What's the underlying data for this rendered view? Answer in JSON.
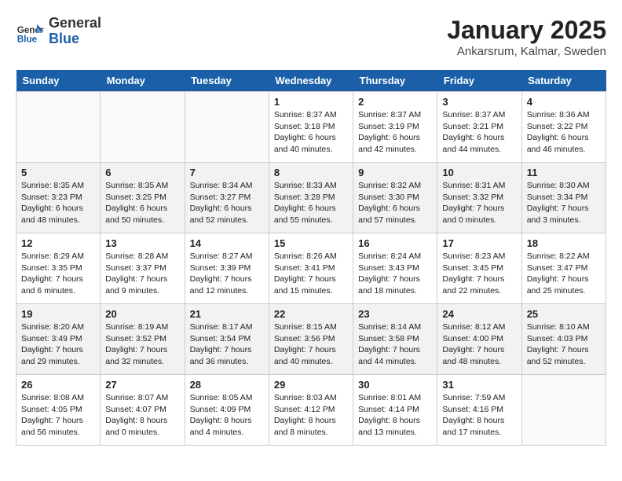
{
  "header": {
    "logo_general": "General",
    "logo_blue": "Blue",
    "title": "January 2025",
    "subtitle": "Ankarsrum, Kalmar, Sweden"
  },
  "weekdays": [
    "Sunday",
    "Monday",
    "Tuesday",
    "Wednesday",
    "Thursday",
    "Friday",
    "Saturday"
  ],
  "weeks": [
    [
      {
        "day": "",
        "info": ""
      },
      {
        "day": "",
        "info": ""
      },
      {
        "day": "",
        "info": ""
      },
      {
        "day": "1",
        "info": "Sunrise: 8:37 AM\nSunset: 3:18 PM\nDaylight: 6 hours\nand 40 minutes."
      },
      {
        "day": "2",
        "info": "Sunrise: 8:37 AM\nSunset: 3:19 PM\nDaylight: 6 hours\nand 42 minutes."
      },
      {
        "day": "3",
        "info": "Sunrise: 8:37 AM\nSunset: 3:21 PM\nDaylight: 6 hours\nand 44 minutes."
      },
      {
        "day": "4",
        "info": "Sunrise: 8:36 AM\nSunset: 3:22 PM\nDaylight: 6 hours\nand 46 minutes."
      }
    ],
    [
      {
        "day": "5",
        "info": "Sunrise: 8:35 AM\nSunset: 3:23 PM\nDaylight: 6 hours\nand 48 minutes."
      },
      {
        "day": "6",
        "info": "Sunrise: 8:35 AM\nSunset: 3:25 PM\nDaylight: 6 hours\nand 50 minutes."
      },
      {
        "day": "7",
        "info": "Sunrise: 8:34 AM\nSunset: 3:27 PM\nDaylight: 6 hours\nand 52 minutes."
      },
      {
        "day": "8",
        "info": "Sunrise: 8:33 AM\nSunset: 3:28 PM\nDaylight: 6 hours\nand 55 minutes."
      },
      {
        "day": "9",
        "info": "Sunrise: 8:32 AM\nSunset: 3:30 PM\nDaylight: 6 hours\nand 57 minutes."
      },
      {
        "day": "10",
        "info": "Sunrise: 8:31 AM\nSunset: 3:32 PM\nDaylight: 7 hours\nand 0 minutes."
      },
      {
        "day": "11",
        "info": "Sunrise: 8:30 AM\nSunset: 3:34 PM\nDaylight: 7 hours\nand 3 minutes."
      }
    ],
    [
      {
        "day": "12",
        "info": "Sunrise: 8:29 AM\nSunset: 3:35 PM\nDaylight: 7 hours\nand 6 minutes."
      },
      {
        "day": "13",
        "info": "Sunrise: 8:28 AM\nSunset: 3:37 PM\nDaylight: 7 hours\nand 9 minutes."
      },
      {
        "day": "14",
        "info": "Sunrise: 8:27 AM\nSunset: 3:39 PM\nDaylight: 7 hours\nand 12 minutes."
      },
      {
        "day": "15",
        "info": "Sunrise: 8:26 AM\nSunset: 3:41 PM\nDaylight: 7 hours\nand 15 minutes."
      },
      {
        "day": "16",
        "info": "Sunrise: 8:24 AM\nSunset: 3:43 PM\nDaylight: 7 hours\nand 18 minutes."
      },
      {
        "day": "17",
        "info": "Sunrise: 8:23 AM\nSunset: 3:45 PM\nDaylight: 7 hours\nand 22 minutes."
      },
      {
        "day": "18",
        "info": "Sunrise: 8:22 AM\nSunset: 3:47 PM\nDaylight: 7 hours\nand 25 minutes."
      }
    ],
    [
      {
        "day": "19",
        "info": "Sunrise: 8:20 AM\nSunset: 3:49 PM\nDaylight: 7 hours\nand 29 minutes."
      },
      {
        "day": "20",
        "info": "Sunrise: 8:19 AM\nSunset: 3:52 PM\nDaylight: 7 hours\nand 32 minutes."
      },
      {
        "day": "21",
        "info": "Sunrise: 8:17 AM\nSunset: 3:54 PM\nDaylight: 7 hours\nand 36 minutes."
      },
      {
        "day": "22",
        "info": "Sunrise: 8:15 AM\nSunset: 3:56 PM\nDaylight: 7 hours\nand 40 minutes."
      },
      {
        "day": "23",
        "info": "Sunrise: 8:14 AM\nSunset: 3:58 PM\nDaylight: 7 hours\nand 44 minutes."
      },
      {
        "day": "24",
        "info": "Sunrise: 8:12 AM\nSunset: 4:00 PM\nDaylight: 7 hours\nand 48 minutes."
      },
      {
        "day": "25",
        "info": "Sunrise: 8:10 AM\nSunset: 4:03 PM\nDaylight: 7 hours\nand 52 minutes."
      }
    ],
    [
      {
        "day": "26",
        "info": "Sunrise: 8:08 AM\nSunset: 4:05 PM\nDaylight: 7 hours\nand 56 minutes."
      },
      {
        "day": "27",
        "info": "Sunrise: 8:07 AM\nSunset: 4:07 PM\nDaylight: 8 hours\nand 0 minutes."
      },
      {
        "day": "28",
        "info": "Sunrise: 8:05 AM\nSunset: 4:09 PM\nDaylight: 8 hours\nand 4 minutes."
      },
      {
        "day": "29",
        "info": "Sunrise: 8:03 AM\nSunset: 4:12 PM\nDaylight: 8 hours\nand 8 minutes."
      },
      {
        "day": "30",
        "info": "Sunrise: 8:01 AM\nSunset: 4:14 PM\nDaylight: 8 hours\nand 13 minutes."
      },
      {
        "day": "31",
        "info": "Sunrise: 7:59 AM\nSunset: 4:16 PM\nDaylight: 8 hours\nand 17 minutes."
      },
      {
        "day": "",
        "info": ""
      }
    ]
  ]
}
